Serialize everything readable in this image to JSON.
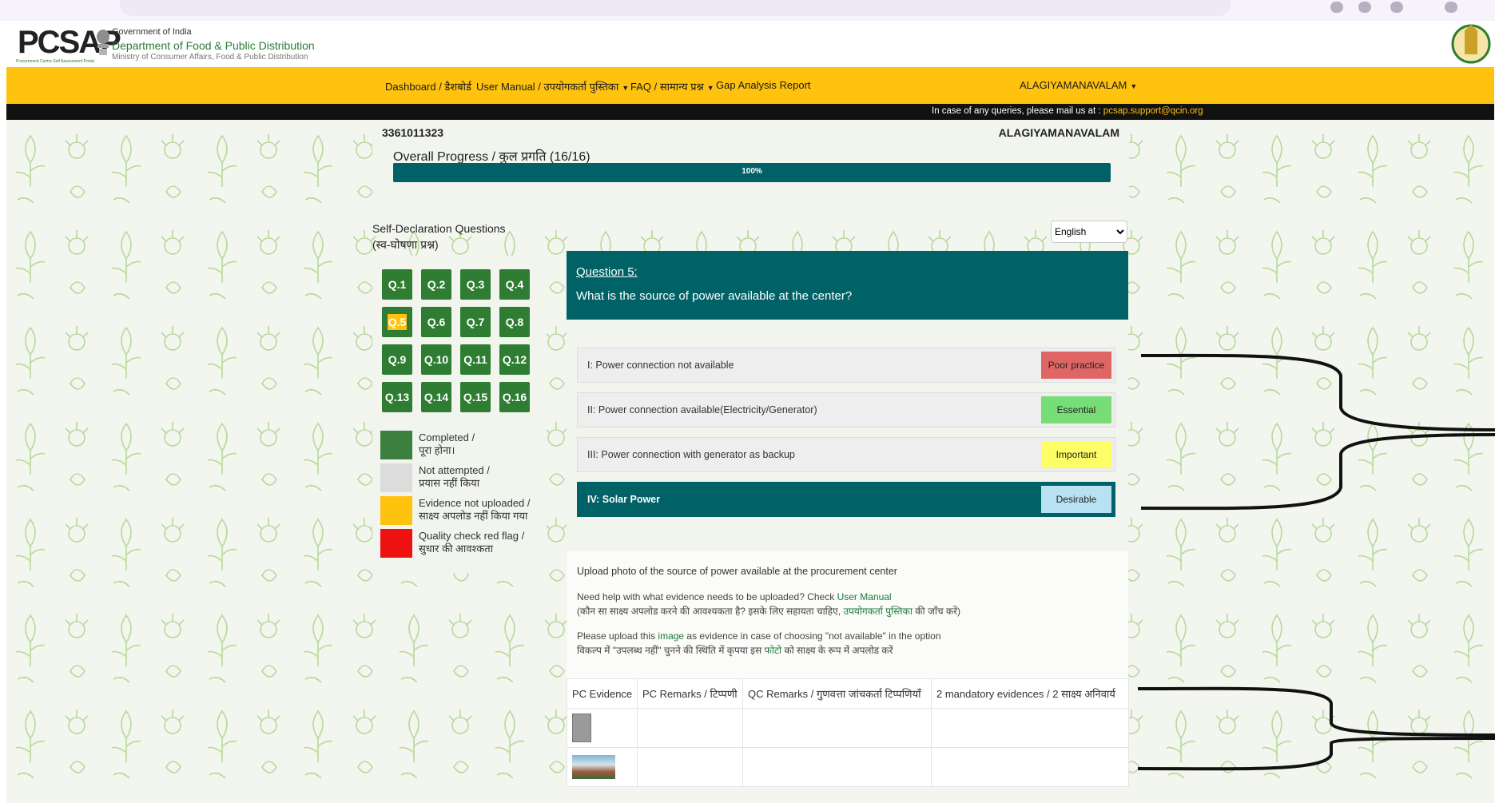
{
  "header": {
    "logo_text": "PCSAP",
    "logo_tagline": "Procurement Centre Self Assessment Portal",
    "gov_line1": "Government of India",
    "gov_line2": "Department of Food & Public Distribution",
    "gov_line3": "Ministry of Consumer Affairs, Food & Public Distribution"
  },
  "nav": {
    "items": [
      {
        "label": "Dashboard / डैशबोर्ड"
      },
      {
        "label": "User Manual / उपयोगकर्ता पुस्तिका"
      },
      {
        "label": "FAQ / सामान्य प्रश्न"
      },
      {
        "label": "Gap Analysis Report"
      }
    ],
    "user": "ALAGIYAMANAVALAM"
  },
  "info_bar": {
    "message": "In case of any queries, please mail us at : ",
    "email": "pcsap.support@qcin.org"
  },
  "center": {
    "id": "3361011323",
    "name": "ALAGIYAMANAVALAM"
  },
  "progress": {
    "label": "Overall Progress / कुल प्रगति (16/16)",
    "percent_text": "100%",
    "fraction": 1.0
  },
  "self_declaration": {
    "title_en": "Self-Declaration Questions",
    "title_hi": "(स्व-घोषणा प्रश्न)"
  },
  "questions": [
    "Q.1",
    "Q.2",
    "Q.3",
    "Q.4",
    "Q.5",
    "Q.6",
    "Q.7",
    "Q.8",
    "Q.9",
    "Q.10",
    "Q.11",
    "Q.12",
    "Q.13",
    "Q.14",
    "Q.15",
    "Q.16"
  ],
  "current_question_index": 4,
  "legend": [
    {
      "line1": "Completed /",
      "line2": "पूरा होना।",
      "color": "#3d7f3f"
    },
    {
      "line1": "Not attempted /",
      "line2": "प्रयास नहीं किया",
      "color": "#dcdcdc"
    },
    {
      "line1": "Evidence not uploaded /",
      "line2": "साक्ष्य अपलोड नहीं किया गया",
      "color": "#ffc20e"
    },
    {
      "line1": "Quality check red flag /",
      "line2": "सुधार की आवश्कता",
      "color": "#ee1111"
    }
  ],
  "language": {
    "selected": "English"
  },
  "question": {
    "number_label": "Question 5:",
    "text": "What is the source of power available at the center?"
  },
  "options": [
    {
      "label": "I: Power connection not available",
      "tag": "Poor practice",
      "tag_color": "#e06666",
      "selected": false
    },
    {
      "label": "II: Power connection available(Electricity/Generator)",
      "tag": "Essential",
      "tag_color": "#77dd77",
      "selected": false
    },
    {
      "label": "III: Power connection with generator as backup",
      "tag": "Important",
      "tag_color": "#fdfd66",
      "selected": false
    },
    {
      "label": "IV: Solar Power",
      "tag": "Desirable",
      "tag_color": "#b8e2f4",
      "selected": true
    }
  ],
  "upload": {
    "title": "Upload photo of the source of power available at the procurement center",
    "help_en_prefix": "Need help with what evidence needs to be uploaded? Check ",
    "help_en_link": "User Manual",
    "help_hi_prefix": "(कौन सा साक्ष्य अपलोड करने की आवश्यकता है? इसके लिए सहायता चाहिए, ",
    "help_hi_link": "उपयोगकर्ता पुस्तिका",
    "help_hi_suffix": " की जाँच करें)",
    "note_en_prefix": "Please upload this ",
    "note_en_link": "image",
    "note_en_suffix": " as evidence in case of choosing \"not available\" in the option",
    "note_hi_prefix": "विकल्प में \"उपलब्ध नहीं\" चुनने की स्थिति में कृपया इस ",
    "note_hi_link": "फोटो",
    "note_hi_suffix": " को साक्ष्य के रूप में अपलोड करें"
  },
  "evidence_table": {
    "headers": [
      "PC Evidence",
      "PC Remarks / टिप्पणी",
      "QC Remarks / गुणवत्ता जांचकर्ता टिप्पणियाँ",
      "2 mandatory evidences / 2 साक्ष्य अनिवार्य"
    ]
  }
}
